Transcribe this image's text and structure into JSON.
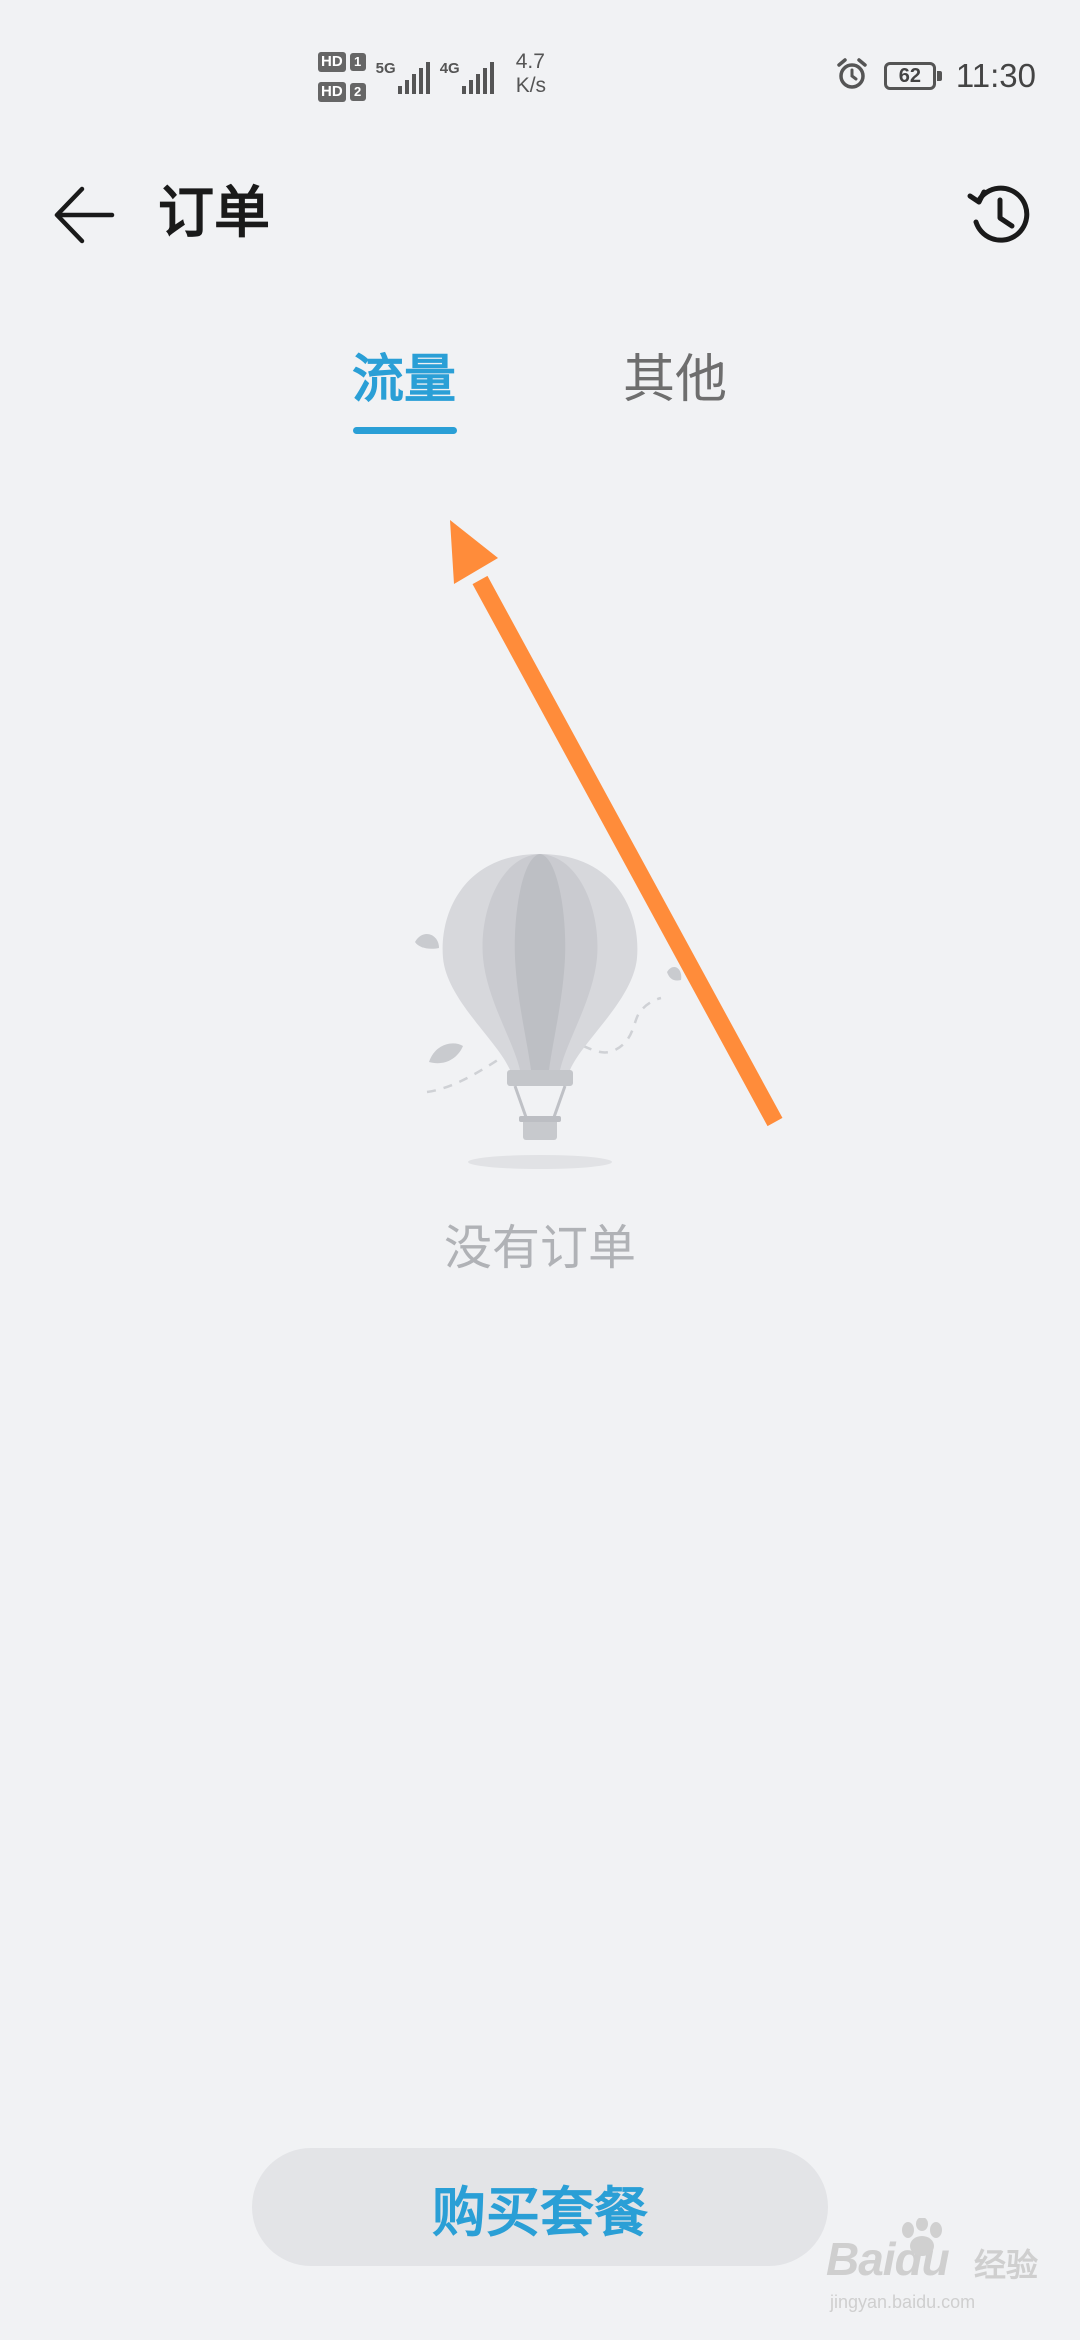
{
  "status_bar": {
    "sim1_badge": "HD",
    "sim1_number": "1",
    "sim2_badge": "HD",
    "sim2_number": "2",
    "network_1": "5G",
    "network_2": "4G",
    "speed_value": "4.7",
    "speed_unit": "K/s",
    "battery_level": "62",
    "time": "11:30",
    "icons": [
      "alarm-icon",
      "battery-icon",
      "signal-icon"
    ]
  },
  "header": {
    "title": "订单",
    "back_icon": "arrow-left-icon",
    "history_icon": "history-clock-icon"
  },
  "tabs": [
    {
      "label": "流量",
      "active": true
    },
    {
      "label": "其他",
      "active": false
    }
  ],
  "empty_state": {
    "message": "没有订单",
    "illustration": "hot-air-balloon"
  },
  "annotation": {
    "type": "arrow",
    "color": "#ff8c3a",
    "points_to": "tab-data"
  },
  "bottom_action": {
    "label": "购买套餐"
  },
  "watermark": {
    "brand": "Baidu",
    "brand_cn": "经验",
    "url": "jingyan.baidu.com"
  },
  "colors": {
    "accent": "#2a9fd6",
    "background": "#f1f2f4",
    "muted_text": "#b0b2b6",
    "button_bg": "#e3e4e7"
  }
}
